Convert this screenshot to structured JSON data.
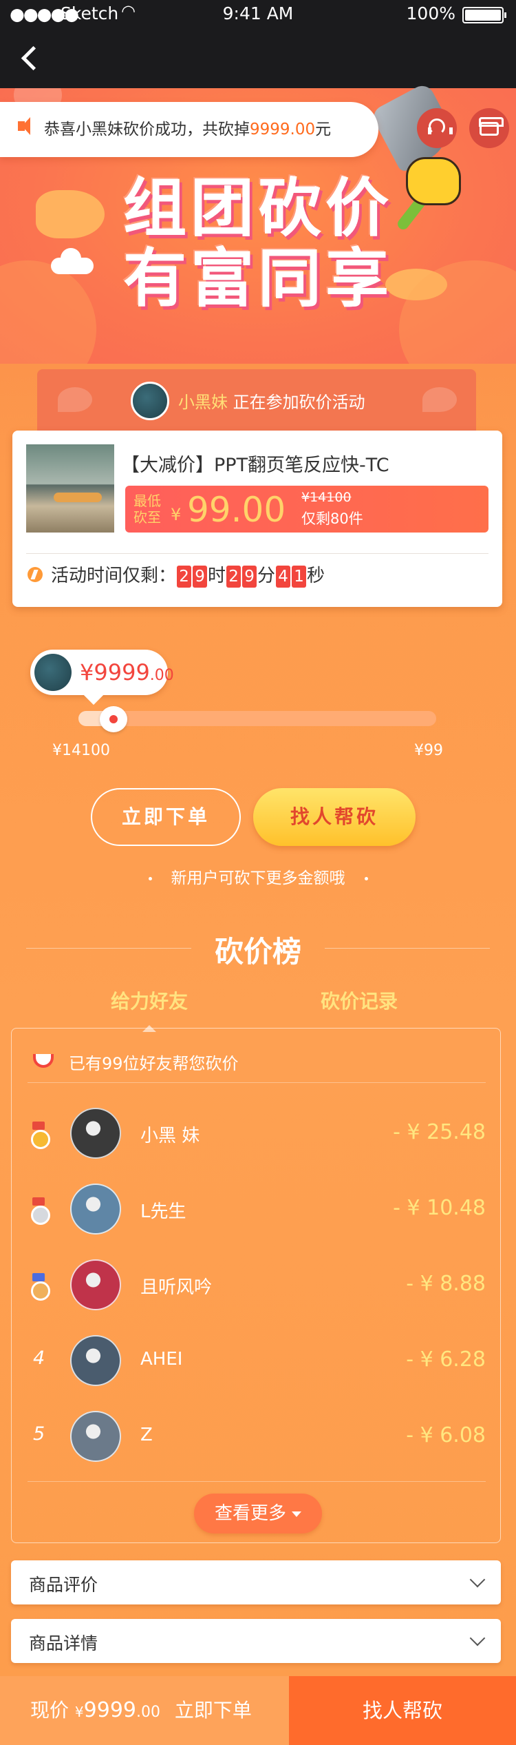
{
  "status_bar": {
    "carrier": "Sketch",
    "time": "9:41 AM",
    "battery": "100%"
  },
  "hero": {
    "notice_prefix": "恭喜小黑妹砍价成功，共砍掉",
    "notice_amount": "9999.00",
    "notice_suffix": "元",
    "title_line1": "组团砍价",
    "title_line2": "有富同享"
  },
  "participant": {
    "name": "小黑妹",
    "text": "正在参加砍价活动"
  },
  "product": {
    "title": "【大减价】PPT翻页笔反应快-TC",
    "lowest_label": "最低砍至",
    "currency": "¥",
    "price": "99.00",
    "original_price": "¥14100",
    "stock_left": "仅剩80件",
    "countdown_label": "活动时间仅剩：",
    "hours": [
      "2",
      "9"
    ],
    "minutes": [
      "2",
      "9"
    ],
    "seconds": [
      "4",
      "1"
    ],
    "unit_hour": "时",
    "unit_minute": "分",
    "unit_second": "秒"
  },
  "progress": {
    "bubble_amount": "¥9999",
    "bubble_amount_decimal": ".00",
    "start_label": "¥14100",
    "end_label": "¥99",
    "fraction": 0.06
  },
  "actions": {
    "order_now": "立即下单",
    "find_help": "找人帮砍",
    "tip": "新用户可砍下更多金额哦"
  },
  "ranking": {
    "title": "砍价榜",
    "tabs": [
      "给力好友",
      "砍价记录"
    ],
    "header": "已有99位好友帮您砍价",
    "rows": [
      {
        "rank": "",
        "medal": "gold",
        "name": "小黑 妹",
        "amount": "- ¥ 25.48",
        "avatar_color": "#3a3a3a"
      },
      {
        "rank": "",
        "medal": "silver",
        "name": "L先生",
        "amount": "- ¥ 10.48",
        "avatar_color": "#5f86a6"
      },
      {
        "rank": "",
        "medal": "bronze",
        "name": "且听风吟",
        "amount": "- ¥ 8.88",
        "avatar_color": "#c0334a"
      },
      {
        "rank": "4",
        "medal": "",
        "name": "AHEI",
        "amount": "- ¥ 6.28",
        "avatar_color": "#4a5c6e"
      },
      {
        "rank": "5",
        "medal": "",
        "name": "Z",
        "amount": "- ¥ 6.08",
        "avatar_color": "#6b7a8a"
      }
    ],
    "view_more": "查看更多"
  },
  "sections": {
    "reviews": "商品评价",
    "details": "商品详情"
  },
  "bottom_bar": {
    "price_label": "现价",
    "currency": "¥",
    "price": "9999",
    "price_decimal": ".00",
    "order_now": "立即下单",
    "find_help": "找人帮砍"
  }
}
